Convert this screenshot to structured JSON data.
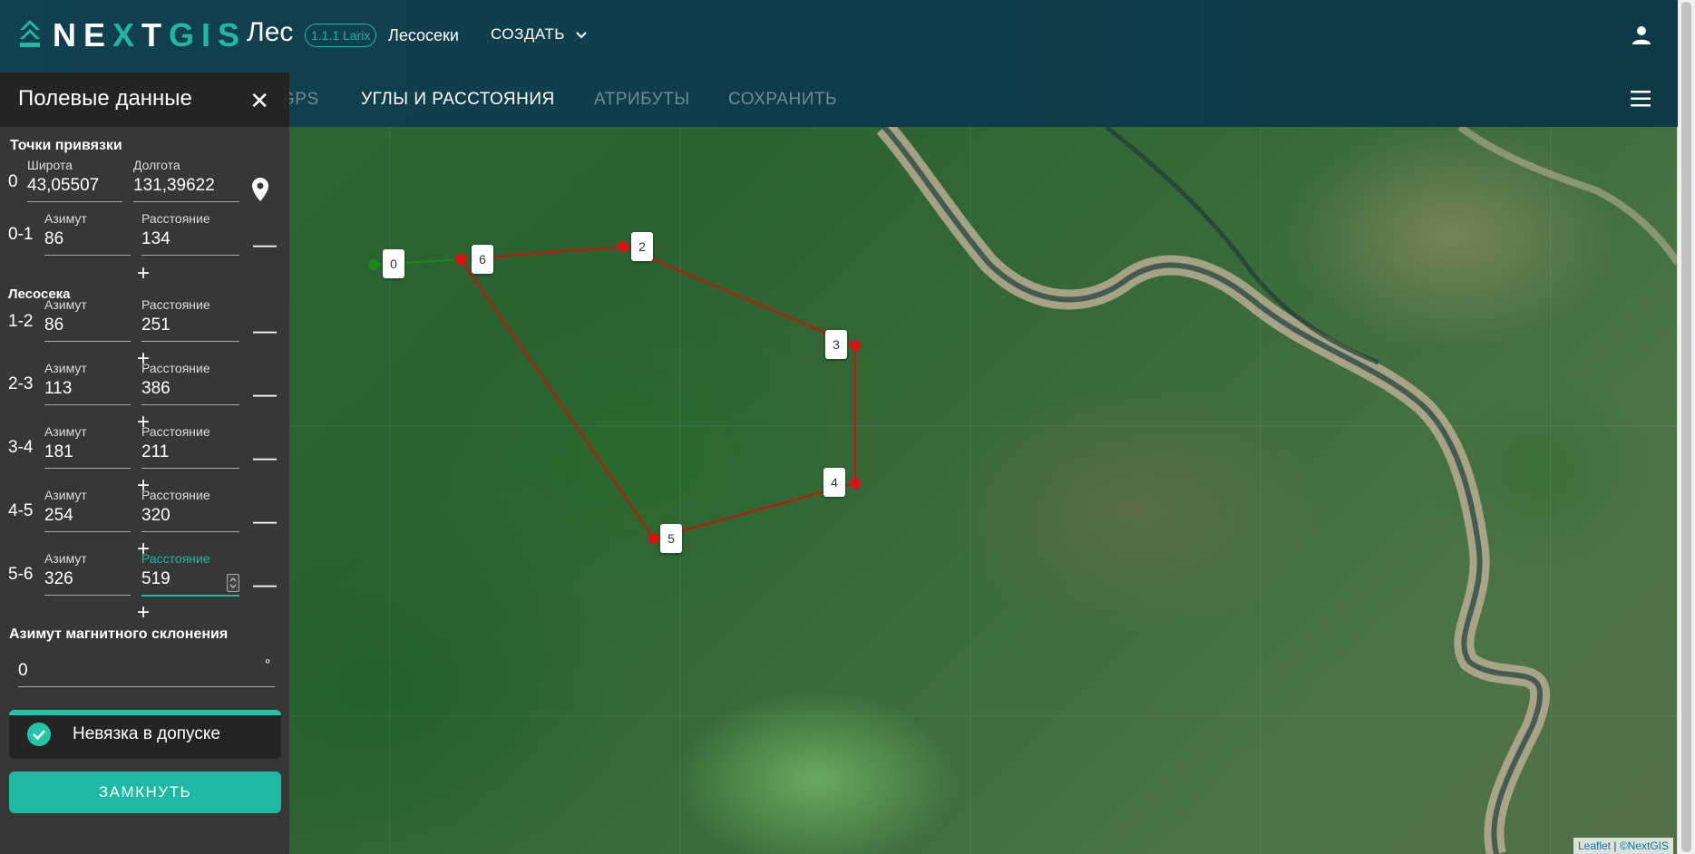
{
  "header": {
    "logo": "NEXTGIS",
    "app_name": "Лес",
    "version": "1.1.1 Larix",
    "module": "Лесосеки",
    "create_label": "СОЗДАТЬ",
    "user_icon": "user-icon",
    "menu_icon": "hamburger-icon"
  },
  "tabs": [
    {
      "label": "GPS"
    },
    {
      "label": "УГЛЫ И РАССТОЯНИЯ"
    },
    {
      "label": "АТРИБУТЫ"
    },
    {
      "label": "СОХРАНИТЬ"
    }
  ],
  "panel": {
    "title": "Полевые данные",
    "anchor_section": "Точки привязки",
    "lat_label": "Широта",
    "lon_label": "Долгота",
    "anchor_index": "0",
    "lat_value": "43,05507",
    "lon_value": "131,39622",
    "azimuth_label": "Азимут",
    "distance_label": "Расстояние",
    "anchor_leg": {
      "index": "0-1",
      "azimuth": "86",
      "distance": "134"
    },
    "cut_section": "Лесосека",
    "legs": [
      {
        "index": "1-2",
        "azimuth": "86",
        "distance": "251"
      },
      {
        "index": "2-3",
        "azimuth": "113",
        "distance": "386"
      },
      {
        "index": "3-4",
        "azimuth": "181",
        "distance": "211"
      },
      {
        "index": "4-5",
        "azimuth": "254",
        "distance": "320"
      },
      {
        "index": "5-6",
        "azimuth": "326",
        "distance": "519"
      }
    ],
    "declination_label": "Азимут магнитного склонения",
    "declination_value": "0",
    "degree": "°",
    "status_text": "Невязка в допуске",
    "close_button": "ЗАМКНУТЬ",
    "plus": "+",
    "minus": "—",
    "close_x": "✕"
  },
  "map": {
    "labels": [
      "0",
      "6",
      "2",
      "3",
      "4",
      "5"
    ],
    "attribution_leaflet": "Leaflet",
    "attribution_sep": " | ",
    "attribution_nextgis": "©NextGIS"
  },
  "colors": {
    "accent": "#1fb8a3",
    "header": "#0f3c4a",
    "panel": "#373737",
    "line": "#cc1111",
    "start": "#1a8a1a"
  }
}
